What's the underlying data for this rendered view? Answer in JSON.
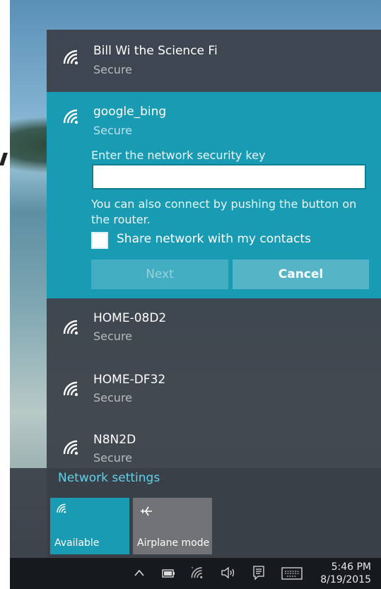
{
  "networks_top": {
    "name": "Bill Wi the Science Fi",
    "status": "Secure"
  },
  "selected": {
    "name": "google_bing",
    "status": "Secure",
    "key_label": "Enter the network security key",
    "key_value": "",
    "hint": "You can also connect by pushing the button on the router.",
    "share_label": "Share network with my contacts",
    "next_label": "Next",
    "cancel_label": "Cancel"
  },
  "networks": [
    {
      "name": "HOME-08D2",
      "status": "Secure"
    },
    {
      "name": "HOME-DF32",
      "status": "Secure"
    },
    {
      "name": "N8N2D",
      "status": "Secure"
    }
  ],
  "settings_link": "Network settings",
  "tiles": {
    "available": "Available",
    "airplane": "Airplane mode"
  },
  "taskbar": {
    "time": "5:46 PM",
    "date": "8/19/2015"
  },
  "colors": {
    "accent": "#1a9bb4",
    "link": "#5fd1e8",
    "flyout": "#3a4048"
  },
  "icons": [
    "wifi-icon",
    "airplane-icon",
    "chevron-up-icon",
    "battery-icon",
    "volume-icon",
    "action-center-icon",
    "keyboard-icon"
  ]
}
